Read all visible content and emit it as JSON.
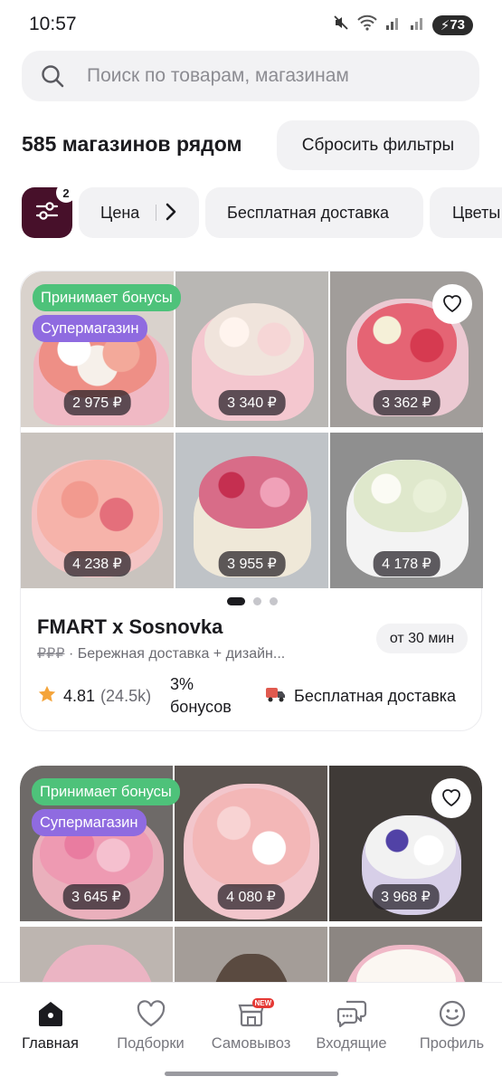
{
  "status_bar": {
    "time": "10:57",
    "battery": "73"
  },
  "search": {
    "placeholder": "Поиск по товарам, магазинам",
    "value": ""
  },
  "header": {
    "title": "585 магазинов рядом",
    "reset_label": "Сбросить фильтры"
  },
  "filters": {
    "active_count": "2",
    "chips": [
      "Цена",
      "Бесплатная доставка",
      "Цветы"
    ]
  },
  "stores": [
    {
      "badges": [
        "Принимает бонусы",
        "Супермагазин"
      ],
      "prices": [
        "2 975 ₽",
        "3 340 ₽",
        "3 362 ₽",
        "4 238 ₽",
        "3 955 ₽",
        "4 178 ₽"
      ],
      "name": "FMART x Sosnovka",
      "price_level": "₽₽₽",
      "description": " · Бережная доставка + дизайн...",
      "eta": "от 30 мин",
      "rating": "4.81",
      "rating_count": "(24.5k)",
      "bonus_pct": "3%",
      "bonus_label": "бонусов",
      "delivery": "Бесплатная доставка"
    },
    {
      "badges": [
        "Принимает бонусы",
        "Супермагазин"
      ],
      "prices": [
        "3 645 ₽",
        "4 080 ₽",
        "3 968 ₽"
      ]
    }
  ],
  "nav": {
    "items": [
      "Главная",
      "Подборки",
      "Самовывоз",
      "Входящие",
      "Профиль"
    ],
    "new_badge": "NEW"
  },
  "colors": {
    "accent": "#47102a",
    "bonus_badge": "#4ec27a",
    "super_badge": "#8f6be0",
    "rating_star": "#f4a43a"
  }
}
